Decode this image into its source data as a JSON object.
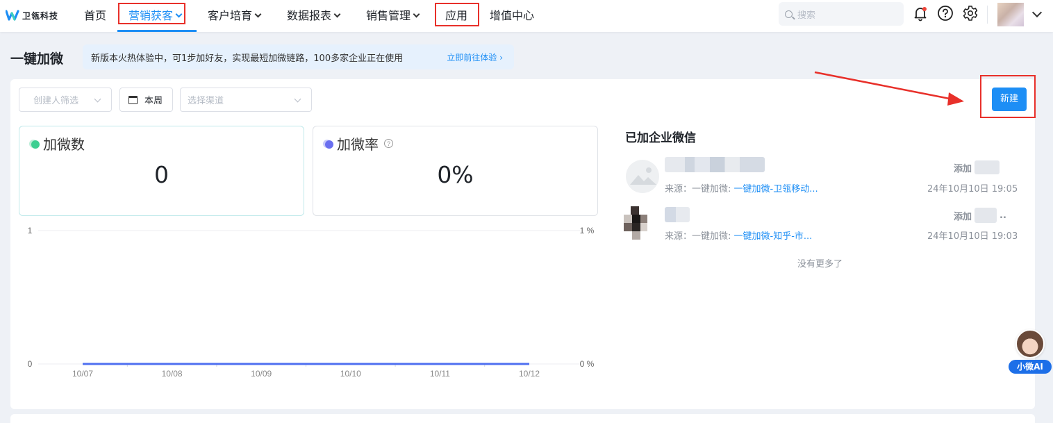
{
  "brand": {
    "name": "卫瓴科技",
    "color": "#1d8ef5"
  },
  "nav": {
    "items": [
      {
        "label": "首页",
        "has_dropdown": false,
        "active": false
      },
      {
        "label": "营销获客",
        "has_dropdown": true,
        "active": true
      },
      {
        "label": "客户培育",
        "has_dropdown": true,
        "active": false
      },
      {
        "label": "数据报表",
        "has_dropdown": true,
        "active": false
      },
      {
        "label": "销售管理",
        "has_dropdown": true,
        "active": false
      },
      {
        "label": "应用",
        "has_dropdown": false,
        "active": false
      },
      {
        "label": "增值中心",
        "has_dropdown": false,
        "active": false
      }
    ],
    "search_placeholder": "搜索",
    "icons": [
      "bell-icon",
      "help-icon",
      "gear-icon"
    ]
  },
  "page": {
    "title": "一键加微",
    "banner_text": "新版本火热体验中，可1步加好友，实现最短加微链路，100多家企业正在使用",
    "banner_link": "立即前往体验 ›",
    "new_button": "新建"
  },
  "filters": {
    "creator_placeholder": "创建人筛选",
    "period": "本周",
    "channel_placeholder": "选择渠道"
  },
  "stats": [
    {
      "label": "加微数",
      "value": "0",
      "dot_color": "#3ccf91"
    },
    {
      "label": "加微率",
      "value": "0%",
      "dot_color": "#6a6ff0",
      "has_help": true
    }
  ],
  "chart_data": {
    "type": "line",
    "categories": [
      "10/07",
      "10/08",
      "10/09",
      "10/10",
      "10/11",
      "10/12"
    ],
    "series": [
      {
        "values": [
          0,
          0,
          0,
          0,
          0,
          0
        ],
        "color": "#4f6ff0"
      }
    ],
    "y_left_ticks": [
      "1",
      "0"
    ],
    "y_right_ticks": [
      "1 %",
      "0 %"
    ],
    "ylim": [
      0,
      1
    ],
    "grid": true
  },
  "list": {
    "title": "已加企业微信",
    "rows": [
      {
        "source_prefix": "来源：一键加微: ",
        "source_link": "一键加微-卫瓴移动...",
        "time": "24年10月10日 19:05",
        "added_label": "添加"
      },
      {
        "source_prefix": "来源：一键加微: ",
        "source_link": "一键加微-知乎-市...",
        "time": "24年10月10日 19:03",
        "added_label": "添加",
        "added_suffix": ".."
      }
    ],
    "end_text": "没有更多了"
  },
  "assistant": {
    "label": "小微AI"
  },
  "annotation_color": "#e8302a"
}
